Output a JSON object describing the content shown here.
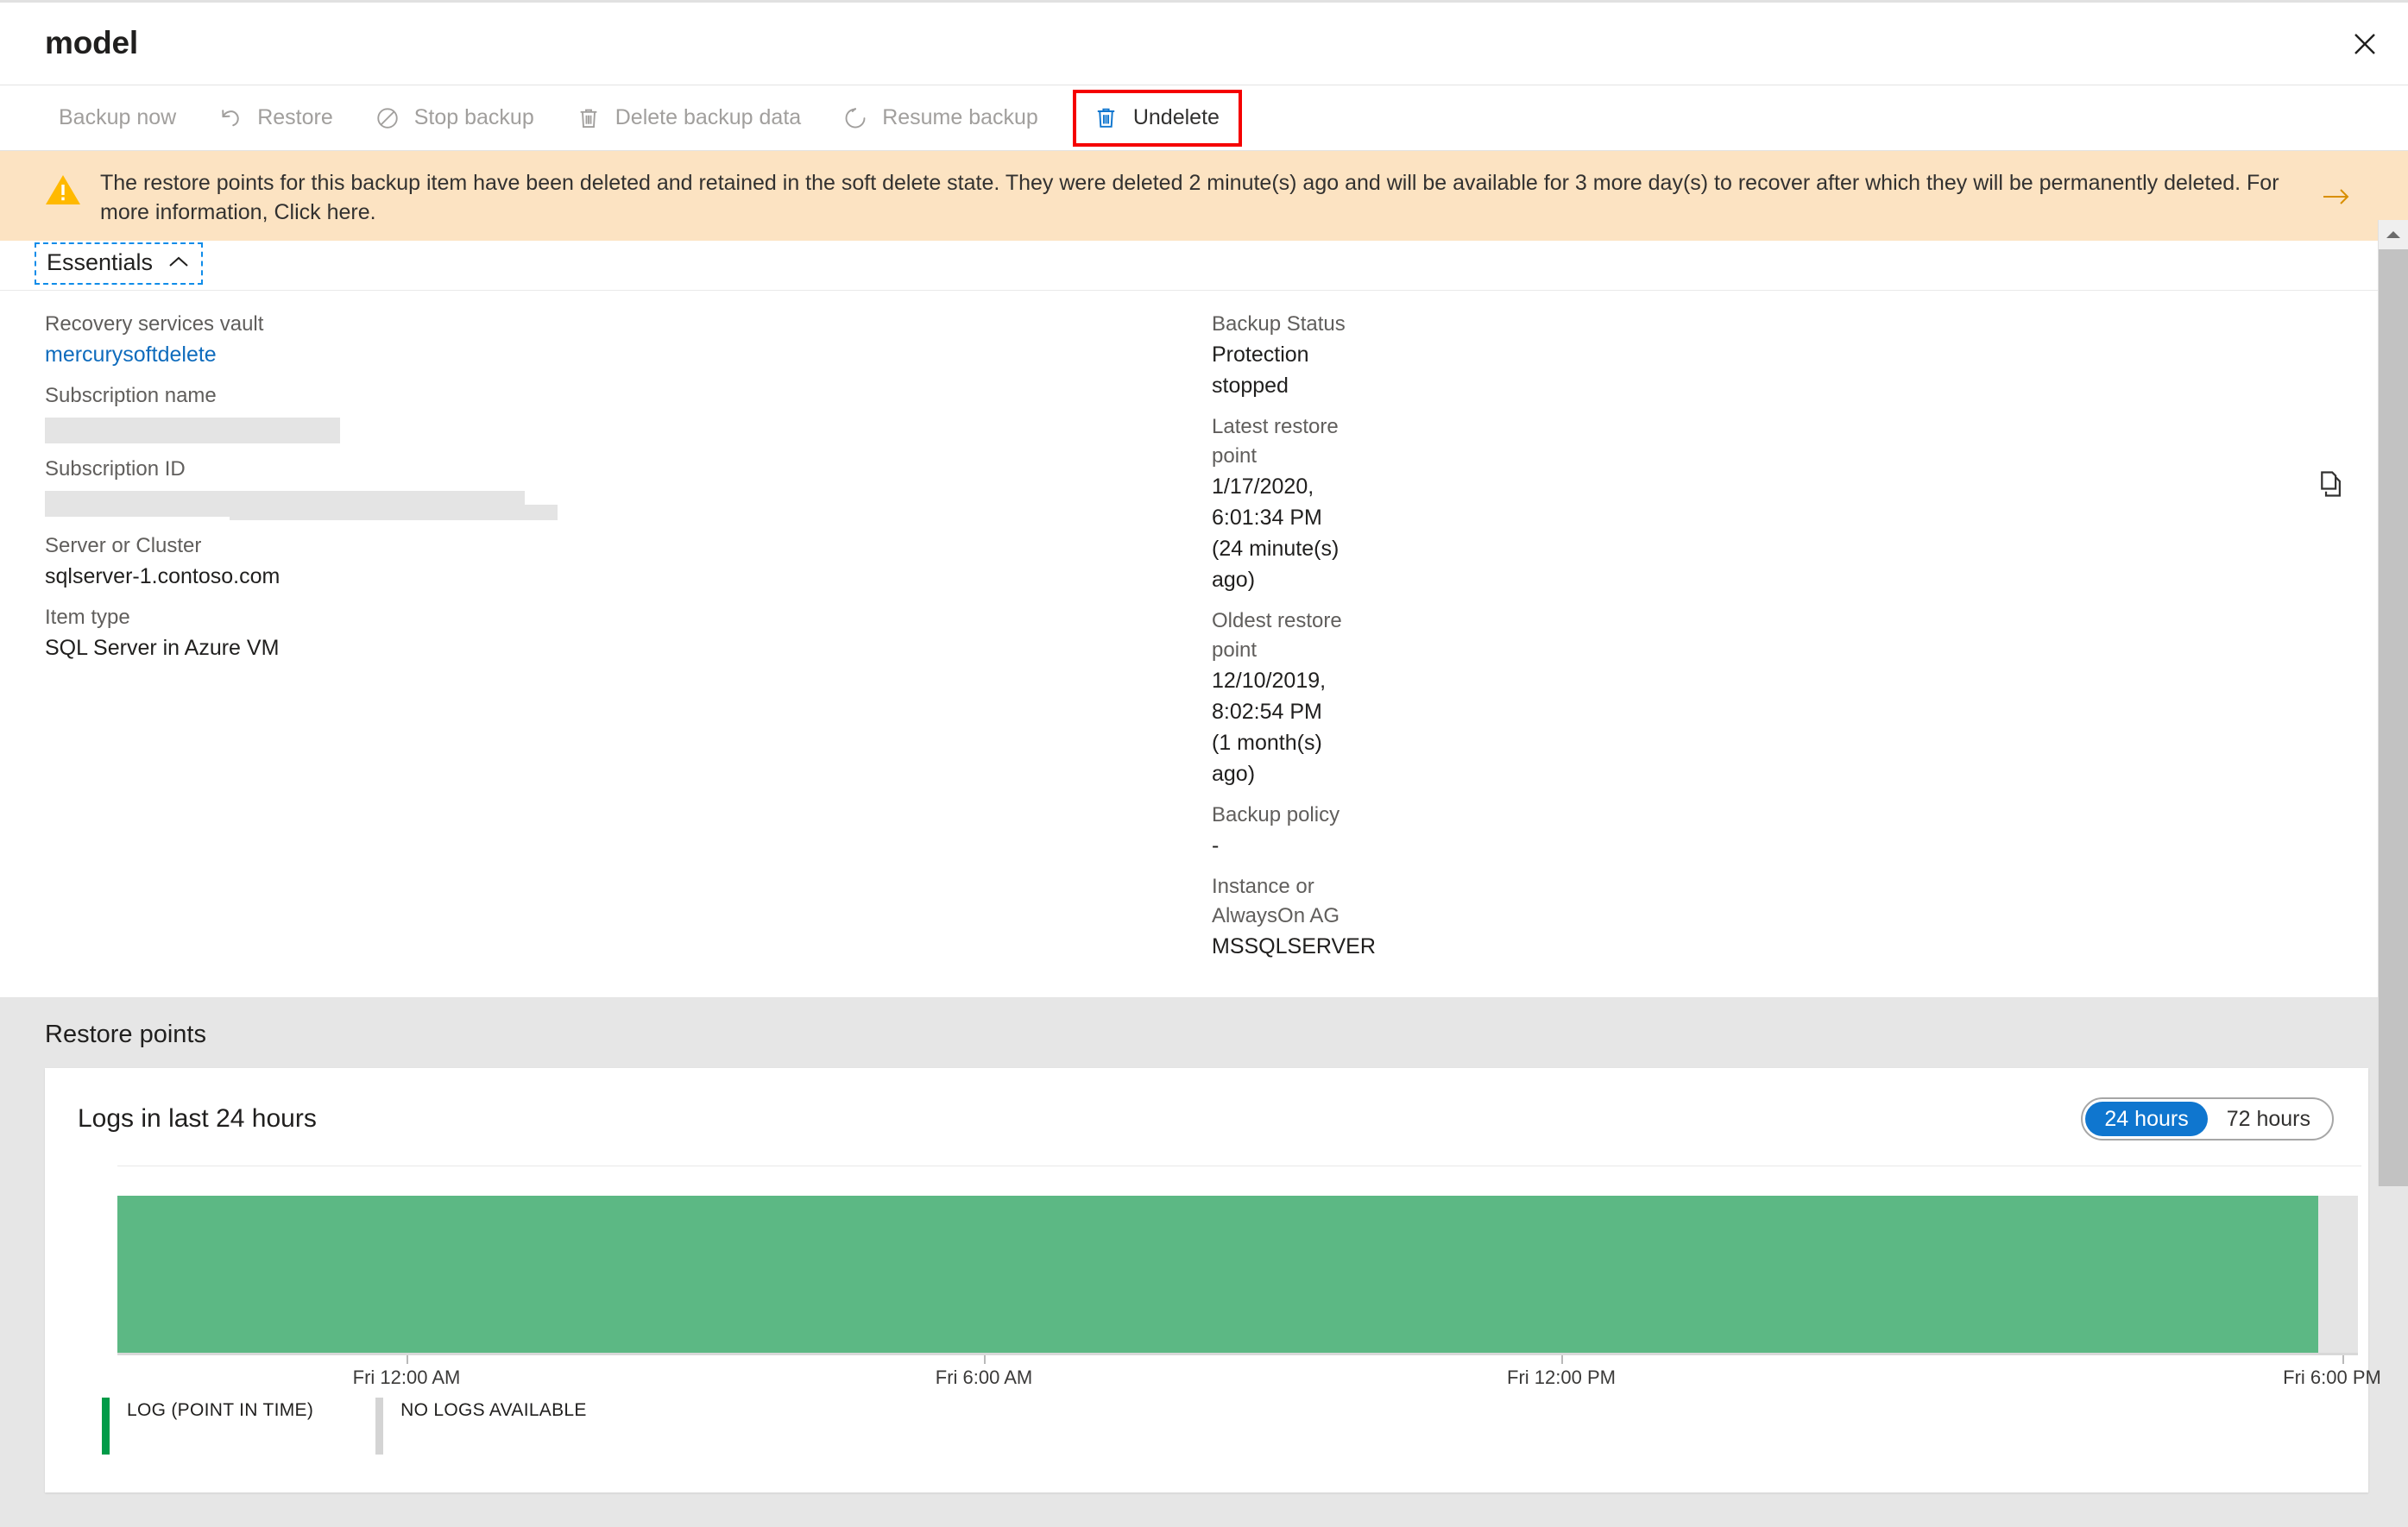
{
  "blade": {
    "title": "model",
    "close_label": "Close"
  },
  "toolbar": {
    "items": [
      {
        "label": "Backup now",
        "icon": "backup-now-icon",
        "enabled": false,
        "has_icon": false
      },
      {
        "label": "Restore",
        "icon": "restore-undo-icon",
        "enabled": false,
        "has_icon": true
      },
      {
        "label": "Stop backup",
        "icon": "stop-circle-icon",
        "enabled": false,
        "has_icon": true
      },
      {
        "label": "Delete backup data",
        "icon": "trash-icon",
        "enabled": false,
        "has_icon": true
      },
      {
        "label": "Resume backup",
        "icon": "resume-refresh-icon",
        "enabled": false,
        "has_icon": true
      },
      {
        "label": "Undelete",
        "icon": "trash-restore-icon",
        "enabled": true,
        "has_icon": true,
        "highlighted": true
      }
    ]
  },
  "banner": {
    "icon": "warning-triangle-icon",
    "text": "The restore points for this backup item have been deleted and retained in the soft delete state. They were deleted 2 minute(s) ago and will be available for 3 more day(s) to recover after which they will be permanently deleted. For more information, Click here.",
    "arrow_icon": "arrow-right-icon",
    "background_color": "#fce3c2",
    "icon_color": "#ffb900"
  },
  "essentials": {
    "toggle_label": "Essentials",
    "toggle_icon": "chevron-up-icon",
    "copy_icon": "copy-icon",
    "left": [
      {
        "key": "Recovery services vault",
        "value": "mercurysoftdelete",
        "is_link": true
      },
      {
        "key": "Subscription name",
        "value": "",
        "redacted": "w1"
      },
      {
        "key": "Subscription ID",
        "value": "",
        "redacted": "w2"
      },
      {
        "key": "Server or Cluster",
        "value": "sqlserver-1.contoso.com"
      },
      {
        "key": "Item type",
        "value": "SQL Server in Azure VM"
      }
    ],
    "right": [
      {
        "key": "Backup Status",
        "value": "Protection stopped"
      },
      {
        "key": "Latest restore point",
        "value": "1/17/2020, 6:01:34 PM (24 minute(s) ago)"
      },
      {
        "key": "Oldest restore point",
        "value": "12/10/2019, 8:02:54 PM (1 month(s) ago)"
      },
      {
        "key": "Backup policy",
        "value": "-"
      },
      {
        "key": "Instance or AlwaysOn AG",
        "value": "MSSQLSERVER"
      }
    ]
  },
  "restore_points": {
    "section_title": "Restore points",
    "chart_title": "Logs in last 24 hours",
    "range_options": [
      {
        "label": "24 hours",
        "active": true
      },
      {
        "label": "72 hours",
        "active": false
      }
    ]
  },
  "chart_data": {
    "type": "bar",
    "title": "Logs in last 24 hours",
    "xlabel": "",
    "ylabel": "",
    "grid": false,
    "legend_position": "bottom-left",
    "tick_labels": [
      "Fri 12:00 AM",
      "Fri 6:00 AM",
      "Fri 12:00 PM",
      "Fri 6:00 PM"
    ],
    "tick_positions_pct": [
      12.9,
      38.6,
      64.3,
      99.2
    ],
    "series": [
      {
        "name": "LOG (POINT IN TIME)",
        "color": "#5cb884",
        "span_start_pct": 0,
        "span_end_pct": 98.1,
        "value": 1
      },
      {
        "name": "NO LOGS AVAILABLE",
        "color": "#e4e4e4",
        "span_start_pct": 98.1,
        "span_end_pct": 100,
        "value": 0
      }
    ],
    "legend": [
      {
        "label": "LOG (POINT IN TIME)",
        "color": "#009b48"
      },
      {
        "label": "NO LOGS AVAILABLE",
        "color": "#d4d4d4"
      }
    ]
  },
  "colors": {
    "accent": "#0f76cf",
    "link": "#0f6cbd",
    "warning_bg": "#fce3c2",
    "highlight_border": "#f50000",
    "green_bar": "#5cb884",
    "gray_bar": "#e4e4e4"
  }
}
